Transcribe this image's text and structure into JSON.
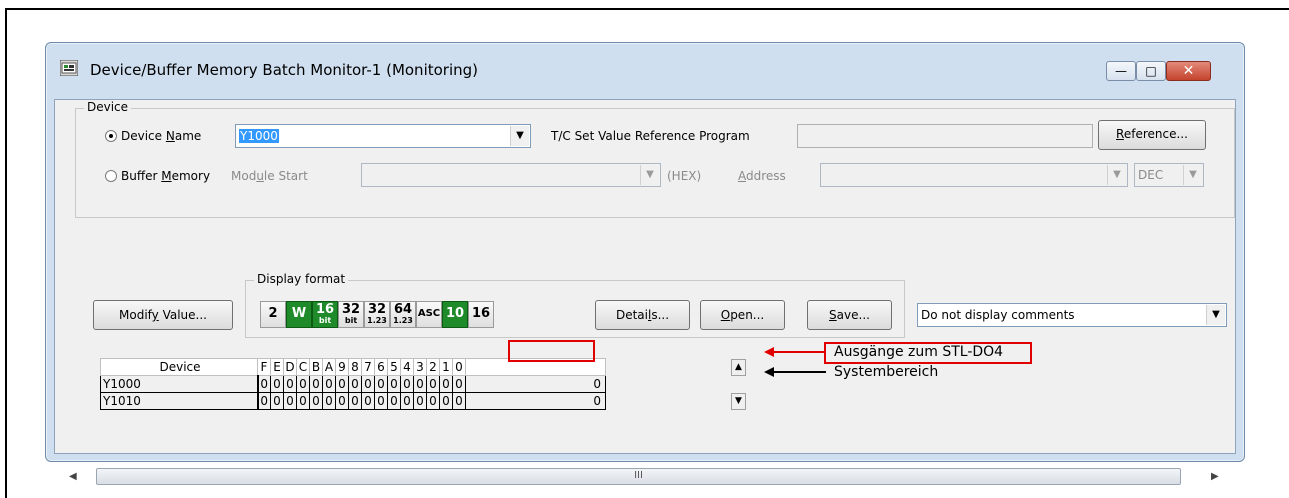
{
  "window": {
    "title": "Device/Buffer Memory Batch Monitor-1 (Monitoring)",
    "controls": {
      "minimize": "—",
      "maximize": "□",
      "close": "✕"
    }
  },
  "device_group": {
    "legend": "Device",
    "device_name_radio": {
      "pre": "Device ",
      "u": "N",
      "post": "ame",
      "selected": true
    },
    "device_name_value": "Y1000",
    "tc_label": "T/C Set Value Reference Program",
    "tc_value": "",
    "reference_button": {
      "u": "R",
      "post": "eference..."
    },
    "buffer_memory_radio": {
      "pre": "Buffer ",
      "u": "M",
      "post": "emory",
      "selected": false
    },
    "module_start_label": {
      "pre": "Mod",
      "u": "u",
      "post": "le Start"
    },
    "hex_label": "(HEX)",
    "address_label": {
      "u": "A",
      "post": "ddress"
    },
    "dec_value": "DEC"
  },
  "toolbar": {
    "modify_value": {
      "pre": "Modif",
      "u": "y",
      "post": " Value..."
    },
    "display_format_legend": "Display format",
    "formats": [
      {
        "id": "bit",
        "text": "2",
        "green": false
      },
      {
        "id": "word",
        "text": "W",
        "green": true
      },
      {
        "id": "16bit",
        "top": "16",
        "bottom": "bit",
        "green": true
      },
      {
        "id": "32bit",
        "top": "32",
        "bottom": "bit",
        "green": false
      },
      {
        "id": "32real",
        "top": "32",
        "bottom": "1.23",
        "green": false
      },
      {
        "id": "64real",
        "top": "64",
        "bottom": "1.23",
        "green": false
      },
      {
        "id": "asc",
        "text": "ASC",
        "green": false
      },
      {
        "id": "dec",
        "text": "10",
        "green": true
      },
      {
        "id": "hex",
        "text": "16",
        "green": false
      }
    ],
    "details": {
      "pre": "Detai",
      "u": "l",
      "post": "s..."
    },
    "open": {
      "u": "O",
      "post": "pen..."
    },
    "save": {
      "u": "S",
      "post": "ave..."
    },
    "comment_option": "Do not display comments"
  },
  "grid": {
    "header_device": "Device",
    "bit_headers": [
      "F",
      "E",
      "D",
      "C",
      "B",
      "A",
      "9",
      "8",
      "7",
      "6",
      "5",
      "4",
      "3",
      "2",
      "1",
      "0"
    ],
    "rows": [
      {
        "device": "Y1000",
        "bits": [
          "0",
          "0",
          "0",
          "0",
          "0",
          "0",
          "0",
          "0",
          "0",
          "0",
          "0",
          "0",
          "0",
          "0",
          "0",
          "0"
        ],
        "value": "0"
      },
      {
        "device": "Y1010",
        "bits": [
          "0",
          "0",
          "0",
          "0",
          "0",
          "0",
          "0",
          "0",
          "0",
          "0",
          "0",
          "0",
          "0",
          "0",
          "0",
          "0"
        ],
        "value": "0"
      }
    ]
  },
  "scrollbar": {
    "grip": "III"
  },
  "annotations": {
    "outputs": "Ausgänge zum STL-DO4",
    "system": "Systembereich",
    "outputs_color": "#e00000",
    "system_color": "#000000"
  }
}
